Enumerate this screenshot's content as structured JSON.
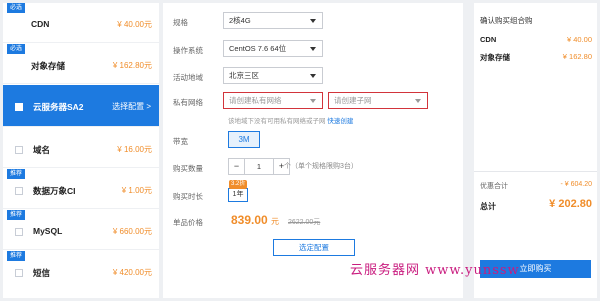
{
  "products": [
    {
      "tag": "必选",
      "name": "CDN",
      "price": "¥ 40.00元",
      "checked": true
    },
    {
      "tag": "必选",
      "name": "对象存储",
      "price": "¥ 162.80元",
      "checked": true
    },
    {
      "tag": "",
      "name": "云服务器SA2",
      "price": "",
      "action": "选择配置 >",
      "active": true
    },
    {
      "tag": "",
      "name": "域名",
      "price": "¥ 16.00元"
    },
    {
      "tag": "推荐",
      "name": "数据万象CI",
      "price": "¥ 1.00元"
    },
    {
      "tag": "推荐",
      "name": "MySQL",
      "price": "¥ 660.00元"
    },
    {
      "tag": "推荐",
      "name": "短信",
      "price": "¥ 420.00元"
    }
  ],
  "config": {
    "spec_label": "规格",
    "spec_value": "2核4G",
    "os_label": "操作系统",
    "os_value": "CentOS 7.6 64位",
    "region_label": "活动地域",
    "region_value": "北京三区",
    "vpc_label": "私有网络",
    "vpc_placeholder": "请创建私有网络",
    "subnet_placeholder": "请创建子网",
    "vpc_hint": "该地域下没有可用私有网络或子网",
    "vpc_hint_link": "快速创建",
    "bandwidth_label": "带宽",
    "bandwidth_value": "3M",
    "qty_label": "购买数量",
    "qty_minus": "−",
    "qty_value": "1",
    "qty_plus": "+",
    "qty_unit": "个（单个规格限购3台）",
    "duration_label": "购买时长",
    "duration_discount": "3.2折",
    "duration_value": "1年",
    "price_label": "单品价格",
    "price_value": "839.00",
    "price_unit": "元",
    "price_original": "2622.00元",
    "select_button": "选定配置"
  },
  "cart": {
    "title": "确认购买组合购",
    "items": [
      {
        "name": "CDN",
        "price": "¥ 40.00"
      },
      {
        "name": "对象存储",
        "price": "¥ 162.80"
      }
    ],
    "discount_label": "优惠合计",
    "discount_value": "- ¥ 604.20",
    "total_label": "总计",
    "total_value": "¥ 202.80",
    "buy_button": "立即购买"
  },
  "watermark": {
    "text": "云服务器网",
    "url": "www.yunssw"
  },
  "colors": {
    "accent": "#1d7ae0",
    "price": "#f08d2a",
    "error": "#d2343b",
    "watermark": "#c91c7f"
  }
}
